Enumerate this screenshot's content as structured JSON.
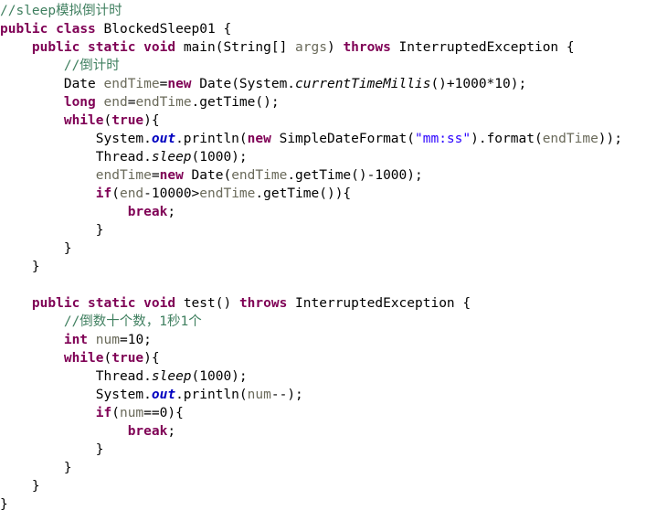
{
  "document": {
    "kind": "java-source-snippet",
    "class_name": "BlockedSleep01",
    "background_color": "#ffffff",
    "colors": {
      "plain": "#000000",
      "keyword": "#7f0055",
      "comment": "#3f7f5f",
      "string": "#2a00ff",
      "variable": "#6a6a5a",
      "static_field": "#0000c0"
    }
  },
  "code": {
    "lines": [
      {
        "indent": 0,
        "tokens": [
          {
            "t": "//sleep模拟倒计时",
            "c": "comment"
          }
        ]
      },
      {
        "indent": 0,
        "tokens": [
          {
            "t": "public",
            "c": "keyword"
          },
          {
            "t": " ",
            "c": "plain"
          },
          {
            "t": "class",
            "c": "keyword"
          },
          {
            "t": " BlockedSleep01 {",
            "c": "plain"
          }
        ]
      },
      {
        "indent": 4,
        "tokens": [
          {
            "t": "public",
            "c": "keyword"
          },
          {
            "t": " ",
            "c": "plain"
          },
          {
            "t": "static",
            "c": "keyword"
          },
          {
            "t": " ",
            "c": "plain"
          },
          {
            "t": "void",
            "c": "keyword"
          },
          {
            "t": " main(String[] ",
            "c": "plain"
          },
          {
            "t": "args",
            "c": "var"
          },
          {
            "t": ") ",
            "c": "plain"
          },
          {
            "t": "throws",
            "c": "keyword"
          },
          {
            "t": " InterruptedException {",
            "c": "plain"
          }
        ]
      },
      {
        "indent": 8,
        "tokens": [
          {
            "t": "//倒计时",
            "c": "comment"
          }
        ]
      },
      {
        "indent": 8,
        "tokens": [
          {
            "t": "Date ",
            "c": "plain"
          },
          {
            "t": "endTime",
            "c": "var"
          },
          {
            "t": "=",
            "c": "plain"
          },
          {
            "t": "new",
            "c": "keyword"
          },
          {
            "t": " Date(System.",
            "c": "plain"
          },
          {
            "t": "currentTimeMillis",
            "c": "staticm"
          },
          {
            "t": "()+1000*10);",
            "c": "plain"
          }
        ]
      },
      {
        "indent": 8,
        "tokens": [
          {
            "t": "long",
            "c": "keyword"
          },
          {
            "t": " ",
            "c": "plain"
          },
          {
            "t": "end",
            "c": "var"
          },
          {
            "t": "=",
            "c": "plain"
          },
          {
            "t": "endTime",
            "c": "var"
          },
          {
            "t": ".getTime();",
            "c": "plain"
          }
        ]
      },
      {
        "indent": 8,
        "tokens": [
          {
            "t": "while",
            "c": "keyword"
          },
          {
            "t": "(",
            "c": "plain"
          },
          {
            "t": "true",
            "c": "keyword"
          },
          {
            "t": "){",
            "c": "plain"
          }
        ]
      },
      {
        "indent": 12,
        "tokens": [
          {
            "t": "System.",
            "c": "plain"
          },
          {
            "t": "out",
            "c": "static"
          },
          {
            "t": ".println(",
            "c": "plain"
          },
          {
            "t": "new",
            "c": "keyword"
          },
          {
            "t": " SimpleDateFormat(",
            "c": "plain"
          },
          {
            "t": "\"mm:ss\"",
            "c": "string"
          },
          {
            "t": ").format(",
            "c": "plain"
          },
          {
            "t": "endTime",
            "c": "var"
          },
          {
            "t": "));",
            "c": "plain"
          }
        ]
      },
      {
        "indent": 12,
        "tokens": [
          {
            "t": "Thread.",
            "c": "plain"
          },
          {
            "t": "sleep",
            "c": "staticm"
          },
          {
            "t": "(1000);",
            "c": "plain"
          }
        ]
      },
      {
        "indent": 12,
        "tokens": [
          {
            "t": "endTime",
            "c": "var"
          },
          {
            "t": "=",
            "c": "plain"
          },
          {
            "t": "new",
            "c": "keyword"
          },
          {
            "t": " Date(",
            "c": "plain"
          },
          {
            "t": "endTime",
            "c": "var"
          },
          {
            "t": ".getTime()-1000);",
            "c": "plain"
          }
        ]
      },
      {
        "indent": 12,
        "tokens": [
          {
            "t": "if",
            "c": "keyword"
          },
          {
            "t": "(",
            "c": "plain"
          },
          {
            "t": "end",
            "c": "var"
          },
          {
            "t": "-10000>",
            "c": "plain"
          },
          {
            "t": "endTime",
            "c": "var"
          },
          {
            "t": ".getTime()){",
            "c": "plain"
          }
        ]
      },
      {
        "indent": 16,
        "tokens": [
          {
            "t": "break",
            "c": "keyword"
          },
          {
            "t": ";",
            "c": "plain"
          }
        ]
      },
      {
        "indent": 12,
        "tokens": [
          {
            "t": "}",
            "c": "plain"
          }
        ]
      },
      {
        "indent": 8,
        "tokens": [
          {
            "t": "}",
            "c": "plain"
          }
        ]
      },
      {
        "indent": 4,
        "tokens": [
          {
            "t": "}",
            "c": "plain"
          }
        ]
      },
      {
        "indent": 0,
        "tokens": []
      },
      {
        "indent": 4,
        "tokens": [
          {
            "t": "public",
            "c": "keyword"
          },
          {
            "t": " ",
            "c": "plain"
          },
          {
            "t": "static",
            "c": "keyword"
          },
          {
            "t": " ",
            "c": "plain"
          },
          {
            "t": "void",
            "c": "keyword"
          },
          {
            "t": " test() ",
            "c": "plain"
          },
          {
            "t": "throws",
            "c": "keyword"
          },
          {
            "t": " InterruptedException {",
            "c": "plain"
          }
        ]
      },
      {
        "indent": 8,
        "tokens": [
          {
            "t": "//倒数十个数，1秒1个",
            "c": "comment"
          }
        ]
      },
      {
        "indent": 8,
        "tokens": [
          {
            "t": "int",
            "c": "keyword"
          },
          {
            "t": " ",
            "c": "plain"
          },
          {
            "t": "num",
            "c": "var"
          },
          {
            "t": "=10;",
            "c": "plain"
          }
        ]
      },
      {
        "indent": 8,
        "tokens": [
          {
            "t": "while",
            "c": "keyword"
          },
          {
            "t": "(",
            "c": "plain"
          },
          {
            "t": "true",
            "c": "keyword"
          },
          {
            "t": "){",
            "c": "plain"
          }
        ]
      },
      {
        "indent": 12,
        "tokens": [
          {
            "t": "Thread.",
            "c": "plain"
          },
          {
            "t": "sleep",
            "c": "staticm"
          },
          {
            "t": "(1000);",
            "c": "plain"
          }
        ]
      },
      {
        "indent": 12,
        "tokens": [
          {
            "t": "System.",
            "c": "plain"
          },
          {
            "t": "out",
            "c": "static"
          },
          {
            "t": ".println(",
            "c": "plain"
          },
          {
            "t": "num",
            "c": "var"
          },
          {
            "t": "--);",
            "c": "plain"
          }
        ]
      },
      {
        "indent": 12,
        "tokens": [
          {
            "t": "if",
            "c": "keyword"
          },
          {
            "t": "(",
            "c": "plain"
          },
          {
            "t": "num",
            "c": "var"
          },
          {
            "t": "==0){",
            "c": "plain"
          }
        ]
      },
      {
        "indent": 16,
        "tokens": [
          {
            "t": "break",
            "c": "keyword"
          },
          {
            "t": ";",
            "c": "plain"
          }
        ]
      },
      {
        "indent": 12,
        "tokens": [
          {
            "t": "}",
            "c": "plain"
          }
        ]
      },
      {
        "indent": 8,
        "tokens": [
          {
            "t": "}",
            "c": "plain"
          }
        ]
      },
      {
        "indent": 4,
        "tokens": [
          {
            "t": "}",
            "c": "plain"
          }
        ]
      },
      {
        "indent": 0,
        "tokens": [
          {
            "t": "}",
            "c": "plain"
          }
        ]
      }
    ]
  }
}
